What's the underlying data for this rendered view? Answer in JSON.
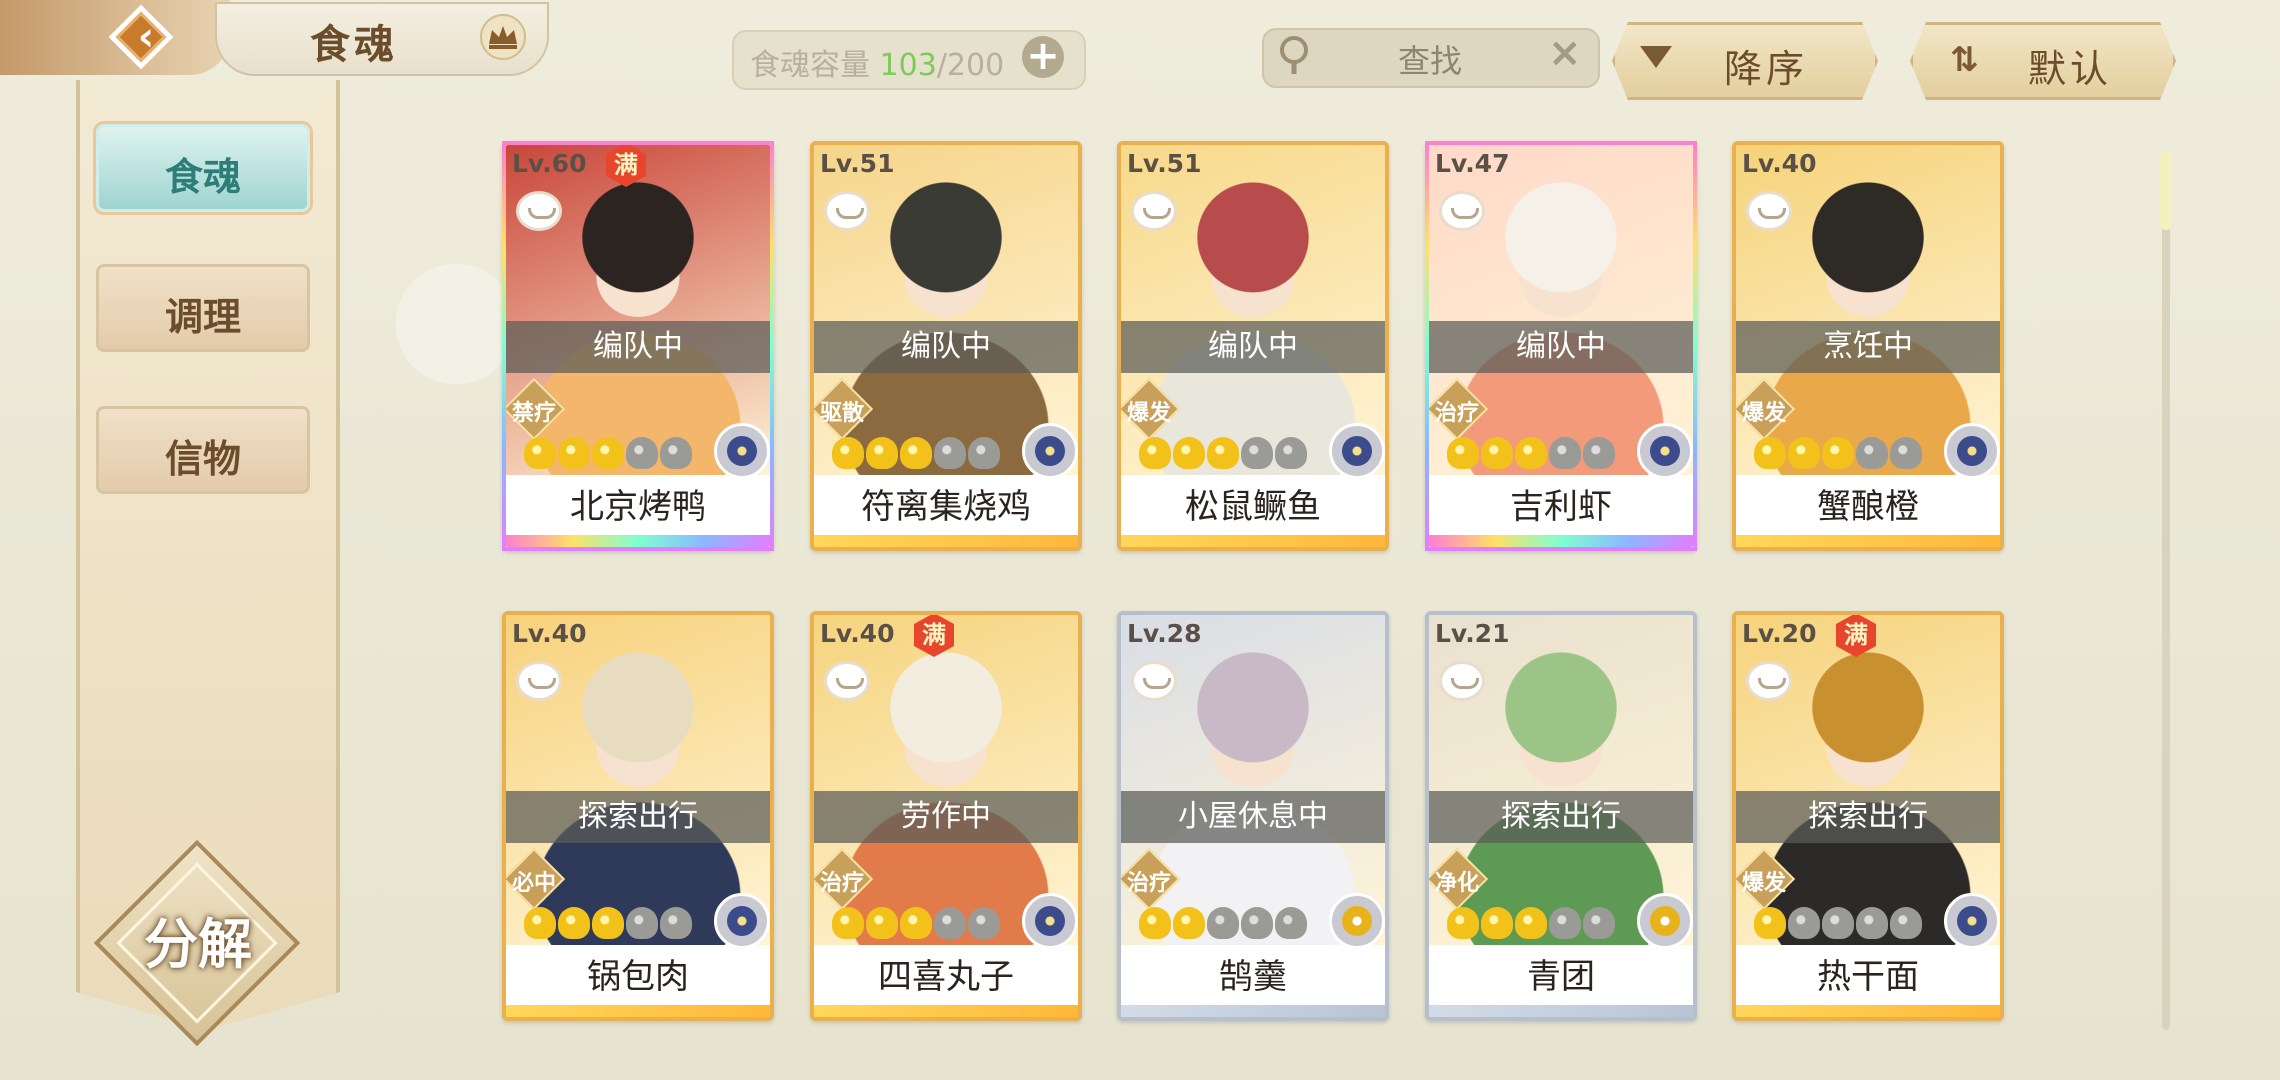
{
  "header": {
    "title": "食魂",
    "capacity_label": "食魂容量 ",
    "capacity_current": "103",
    "capacity_max": "/200",
    "search_label": "查找",
    "sort_order_label": "降序",
    "sort_mode_label": "默认"
  },
  "sidebar": {
    "tabs": [
      {
        "label": "食魂",
        "active": true
      },
      {
        "label": "调理",
        "active": false
      },
      {
        "label": "信物",
        "active": false
      }
    ],
    "decompose_label": "分解"
  },
  "colors": {
    "accent_gold": "#e9b04d",
    "active_tab": "#9fd4d0",
    "capacity_current": "#7ecb5a"
  },
  "cards": [
    {
      "level": "Lv.60",
      "max": "满",
      "status": "编队中",
      "role": "禁疗",
      "stars": 3,
      "name": "北京烤鸭",
      "frame": "rainbow",
      "element": "blue",
      "art": [
        "#c9463a",
        "#f4b66a",
        "#2b2420"
      ]
    },
    {
      "level": "Lv.51",
      "max": "",
      "status": "编队中",
      "role": "驱散",
      "stars": 3,
      "name": "符离集烧鸡",
      "frame": "gold",
      "element": "blue",
      "art": [
        "#f6d58a",
        "#8c6a3f",
        "#3b3b36"
      ]
    },
    {
      "level": "Lv.51",
      "max": "",
      "status": "编队中",
      "role": "爆发",
      "stars": 3,
      "name": "松鼠鳜鱼",
      "frame": "gold",
      "element": "blue",
      "art": [
        "#f7d98a",
        "#e9e6dc",
        "#b84c4c"
      ]
    },
    {
      "level": "Lv.47",
      "max": "",
      "status": "编队中",
      "role": "治疗",
      "stars": 3,
      "name": "吉利虾",
      "frame": "rainbow",
      "element": "blue",
      "art": [
        "#ffd9c8",
        "#f29a7a",
        "#f5f0e8"
      ]
    },
    {
      "level": "Lv.40",
      "max": "",
      "status": "烹饪中",
      "role": "爆发",
      "stars": 3,
      "name": "蟹酿橙",
      "frame": "gold",
      "element": "blue",
      "art": [
        "#f6d37a",
        "#e9a94a",
        "#2e2a25"
      ]
    },
    {
      "level": "Lv.40",
      "max": "",
      "status": "探索出行",
      "role": "必中",
      "stars": 3,
      "name": "锅包肉",
      "frame": "gold",
      "element": "blue",
      "art": [
        "#f7d27c",
        "#2f3a5a",
        "#e8dcc0"
      ]
    },
    {
      "level": "Lv.40",
      "max": "满",
      "status": "劳作中",
      "role": "治疗",
      "stars": 3,
      "name": "四喜丸子",
      "frame": "gold",
      "element": "blue",
      "art": [
        "#f6d47e",
        "#e27b4a",
        "#f3ede0"
      ]
    },
    {
      "level": "Lv.28",
      "max": "",
      "status": "小屋休息中",
      "role": "治疗",
      "stars": 2,
      "name": "鹄羹",
      "frame": "silver",
      "element": "gold",
      "art": [
        "#d9dde6",
        "#f2f2f5",
        "#c9b9c6"
      ]
    },
    {
      "level": "Lv.21",
      "max": "",
      "status": "探索出行",
      "role": "净化",
      "stars": 3,
      "name": "青团",
      "frame": "silver",
      "element": "gold",
      "art": [
        "#e9e1cf",
        "#5d9a54",
        "#9bc486"
      ]
    },
    {
      "level": "Lv.20",
      "max": "满",
      "status": "探索出行",
      "role": "爆发",
      "stars": 1,
      "name": "热干面",
      "frame": "gold",
      "element": "blue",
      "art": [
        "#f6d37c",
        "#2b2a28",
        "#c8902f"
      ]
    }
  ]
}
